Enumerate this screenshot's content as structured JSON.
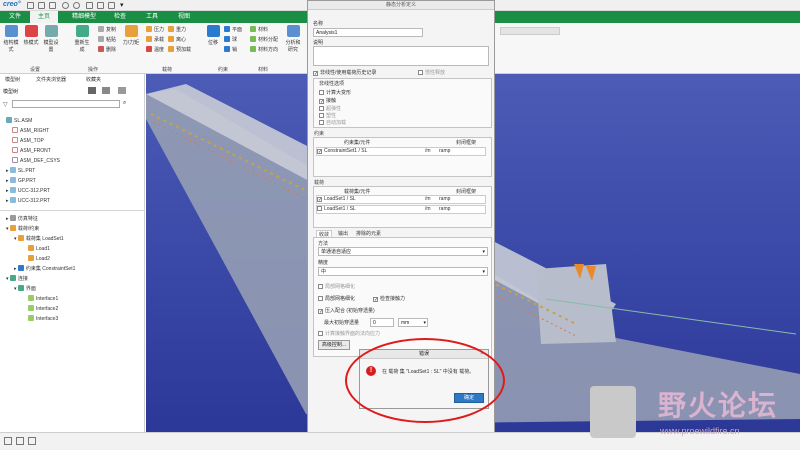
{
  "app": {
    "logo": "creo",
    "logo_suffix": "°"
  },
  "tabs": [
    "文件",
    "主页",
    "精细模型",
    "检查",
    "工具",
    "视图"
  ],
  "ribbon": {
    "big_buttons": [
      "结构模式",
      "热模式",
      "模型设置",
      "重新生成",
      "力/力矩",
      "分析和研究"
    ],
    "small_items": [
      "复制",
      "粘贴",
      "删除",
      "压力",
      "承载",
      "重力",
      "温度",
      "离心",
      "预加载",
      "位移",
      "平面",
      "球",
      "销",
      "材料",
      "材料分配",
      "材料方向"
    ],
    "groups": [
      "设置",
      "操作",
      "载荷",
      "约束",
      "材料"
    ]
  },
  "left_panel": {
    "tabs": [
      "模型树",
      "文件夹浏览器",
      "收藏夹"
    ],
    "tree_label": "模型树",
    "items": [
      {
        "label": "SL.ASM"
      },
      {
        "label": "ASM_RIGHT"
      },
      {
        "label": "ASM_TOP"
      },
      {
        "label": "ASM_FRONT"
      },
      {
        "label": "ASM_DEF_CSYS"
      },
      {
        "label": "SL.PRT"
      },
      {
        "label": "GP.PRT"
      },
      {
        "label": "UCC-312.PRT"
      },
      {
        "label": "UCC-312.PRT"
      },
      {
        "label": "仿真特征"
      },
      {
        "label": "载荷/约束"
      },
      {
        "label": "载荷集 LoadSet1"
      },
      {
        "label": "Load1"
      },
      {
        "label": "Load2"
      },
      {
        "label": "约束集 ConstraintSet1"
      },
      {
        "label": "连接"
      },
      {
        "label": "界面"
      },
      {
        "label": "Interface1"
      },
      {
        "label": "Interface2"
      },
      {
        "label": "Interface3"
      }
    ]
  },
  "dialog": {
    "title": "静态分析定义",
    "name_label": "名称",
    "name_value": "Analysis1",
    "desc_label": "说明",
    "combine_label": "非线性/使用载荷历史记录",
    "inertia_label": "惯性释放",
    "nonlinear_header": "非线性选项",
    "nonlinear_opts": [
      "计算大变形",
      "接触",
      "超弹性",
      "塑性",
      "自动加载"
    ],
    "constraint_header": "约束",
    "constraint_col1": "约束集/元件",
    "constraint_col2": "封闭框架",
    "constraint_rows": [
      {
        "name": "ConstraintSet1 / SL",
        "component": "ramp"
      }
    ],
    "load_header": "载荷",
    "load_col1": "载荷集/元件",
    "load_col2": "封闭框架",
    "load_rows": [
      {
        "name": "LoadSet1 / SL",
        "component": "ramp"
      },
      {
        "name": "LoadSet1 / SL",
        "component": "ramp"
      }
    ],
    "tabs": [
      "收敛",
      "输出",
      "排除的元素"
    ],
    "method_label": "方法",
    "method_value": "单通道自适应",
    "accuracy_label": "精度",
    "accuracy_value": "中",
    "opt_local_mesh": "局部网格细化",
    "opt_rigid": "局部网格细化",
    "opt_contact_check": "检查接触力",
    "opt_press_fit": "压入配合 (初始穿透量)",
    "max_init_label": "最大初始穿透量",
    "max_init_value": "0",
    "max_init_unit": "mm",
    "opt_check_interface": "计算接触界面的法向应力",
    "advanced_button": "高级控制...",
    "ok_button": "确定",
    "cancel_button": "取消"
  },
  "alert": {
    "title": "错误",
    "message": "在 载荷 集 \"LoadSet1 : SL\" 中没有 载荷。",
    "ok_button": "确定"
  },
  "watermark": {
    "text": "野火论坛",
    "url": "www.proewildfire.cn"
  },
  "colors": {
    "tab_bar": "#1b8e45",
    "viewport": "#3947a6",
    "alert_red": "#e01a1a",
    "primary_button": "#2f78c4"
  }
}
